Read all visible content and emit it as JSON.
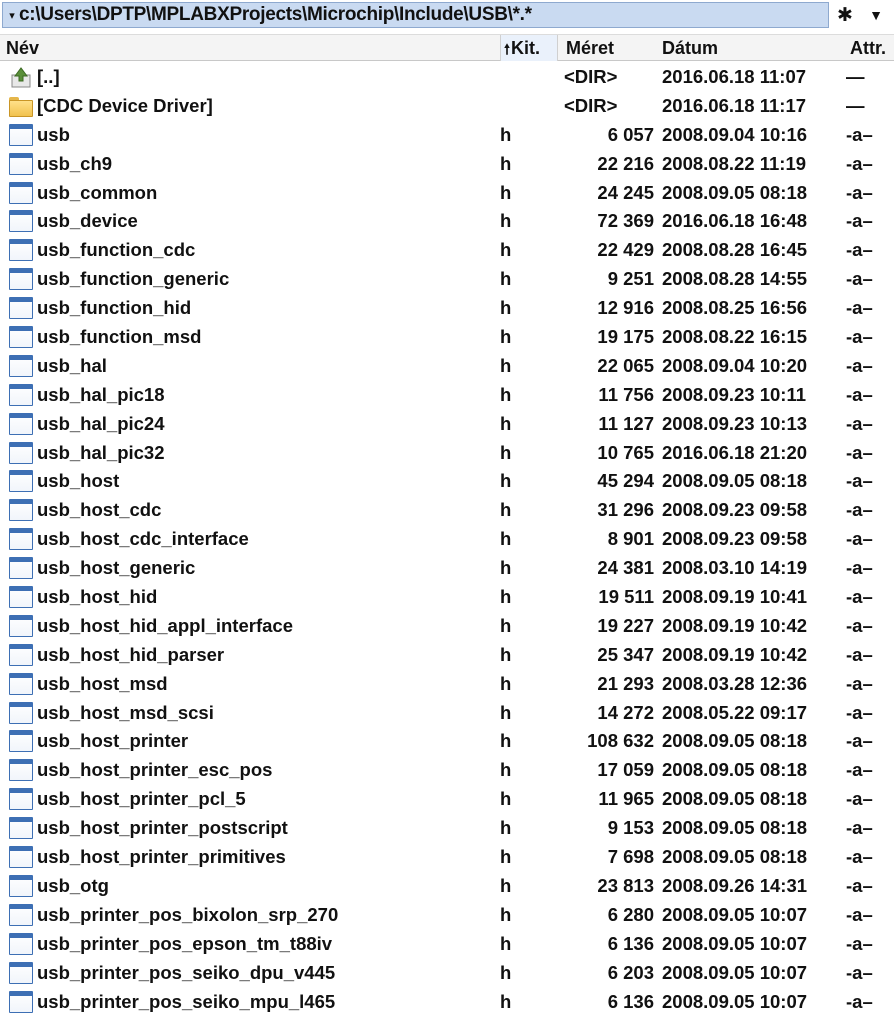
{
  "path": {
    "dropdown_glyph": "▾",
    "text": "c:\\Users\\DPTP\\MPLABXProjects\\Microchip\\Include\\USB\\*.*",
    "filter_glyph": "✱",
    "menu_glyph": "▼"
  },
  "columns": {
    "name": "Név",
    "ext_sort_glyph": "🠕",
    "ext": "Kit.",
    "size": "Méret",
    "date": "Dátum",
    "attr": "Attr."
  },
  "rows": [
    {
      "kind": "up",
      "name": "[..]",
      "ext": "",
      "size": "<DIR>",
      "date": "2016.06.18 11:07",
      "attr": "—"
    },
    {
      "kind": "folder",
      "name": "[CDC Device Driver]",
      "ext": "",
      "size": "<DIR>",
      "date": "2016.06.18 11:17",
      "attr": "—"
    },
    {
      "kind": "file",
      "name": "usb",
      "ext": "h",
      "size": "6 057",
      "date": "2008.09.04 10:16",
      "attr": "-a–"
    },
    {
      "kind": "file",
      "name": "usb_ch9",
      "ext": "h",
      "size": "22 216",
      "date": "2008.08.22 11:19",
      "attr": "-a–"
    },
    {
      "kind": "file",
      "name": "usb_common",
      "ext": "h",
      "size": "24 245",
      "date": "2008.09.05 08:18",
      "attr": "-a–"
    },
    {
      "kind": "file",
      "name": "usb_device",
      "ext": "h",
      "size": "72 369",
      "date": "2016.06.18 16:48",
      "attr": "-a–"
    },
    {
      "kind": "file",
      "name": "usb_function_cdc",
      "ext": "h",
      "size": "22 429",
      "date": "2008.08.28 16:45",
      "attr": "-a–"
    },
    {
      "kind": "file",
      "name": "usb_function_generic",
      "ext": "h",
      "size": "9 251",
      "date": "2008.08.28 14:55",
      "attr": "-a–"
    },
    {
      "kind": "file",
      "name": "usb_function_hid",
      "ext": "h",
      "size": "12 916",
      "date": "2008.08.25 16:56",
      "attr": "-a–"
    },
    {
      "kind": "file",
      "name": "usb_function_msd",
      "ext": "h",
      "size": "19 175",
      "date": "2008.08.22 16:15",
      "attr": "-a–"
    },
    {
      "kind": "file",
      "name": "usb_hal",
      "ext": "h",
      "size": "22 065",
      "date": "2008.09.04 10:20",
      "attr": "-a–"
    },
    {
      "kind": "file",
      "name": "usb_hal_pic18",
      "ext": "h",
      "size": "11 756",
      "date": "2008.09.23 10:11",
      "attr": "-a–"
    },
    {
      "kind": "file",
      "name": "usb_hal_pic24",
      "ext": "h",
      "size": "11 127",
      "date": "2008.09.23 10:13",
      "attr": "-a–"
    },
    {
      "kind": "file",
      "name": "usb_hal_pic32",
      "ext": "h",
      "size": "10 765",
      "date": "2016.06.18 21:20",
      "attr": "-a–"
    },
    {
      "kind": "file",
      "name": "usb_host",
      "ext": "h",
      "size": "45 294",
      "date": "2008.09.05 08:18",
      "attr": "-a–"
    },
    {
      "kind": "file",
      "name": "usb_host_cdc",
      "ext": "h",
      "size": "31 296",
      "date": "2008.09.23 09:58",
      "attr": "-a–"
    },
    {
      "kind": "file",
      "name": "usb_host_cdc_interface",
      "ext": "h",
      "size": "8 901",
      "date": "2008.09.23 09:58",
      "attr": "-a–"
    },
    {
      "kind": "file",
      "name": "usb_host_generic",
      "ext": "h",
      "size": "24 381",
      "date": "2008.03.10 14:19",
      "attr": "-a–"
    },
    {
      "kind": "file",
      "name": "usb_host_hid",
      "ext": "h",
      "size": "19 511",
      "date": "2008.09.19 10:41",
      "attr": "-a–"
    },
    {
      "kind": "file",
      "name": "usb_host_hid_appl_interface",
      "ext": "h",
      "size": "19 227",
      "date": "2008.09.19 10:42",
      "attr": "-a–"
    },
    {
      "kind": "file",
      "name": "usb_host_hid_parser",
      "ext": "h",
      "size": "25 347",
      "date": "2008.09.19 10:42",
      "attr": "-a–"
    },
    {
      "kind": "file",
      "name": "usb_host_msd",
      "ext": "h",
      "size": "21 293",
      "date": "2008.03.28 12:36",
      "attr": "-a–"
    },
    {
      "kind": "file",
      "name": "usb_host_msd_scsi",
      "ext": "h",
      "size": "14 272",
      "date": "2008.05.22 09:17",
      "attr": "-a–"
    },
    {
      "kind": "file",
      "name": "usb_host_printer",
      "ext": "h",
      "size": "108 632",
      "date": "2008.09.05 08:18",
      "attr": "-a–"
    },
    {
      "kind": "file",
      "name": "usb_host_printer_esc_pos",
      "ext": "h",
      "size": "17 059",
      "date": "2008.09.05 08:18",
      "attr": "-a–"
    },
    {
      "kind": "file",
      "name": "usb_host_printer_pcl_5",
      "ext": "h",
      "size": "11 965",
      "date": "2008.09.05 08:18",
      "attr": "-a–"
    },
    {
      "kind": "file",
      "name": "usb_host_printer_postscript",
      "ext": "h",
      "size": "9 153",
      "date": "2008.09.05 08:18",
      "attr": "-a–"
    },
    {
      "kind": "file",
      "name": "usb_host_printer_primitives",
      "ext": "h",
      "size": "7 698",
      "date": "2008.09.05 08:18",
      "attr": "-a–"
    },
    {
      "kind": "file",
      "name": "usb_otg",
      "ext": "h",
      "size": "23 813",
      "date": "2008.09.26 14:31",
      "attr": "-a–"
    },
    {
      "kind": "file",
      "name": "usb_printer_pos_bixolon_srp_270",
      "ext": "h",
      "size": "6 280",
      "date": "2008.09.05 10:07",
      "attr": "-a–"
    },
    {
      "kind": "file",
      "name": "usb_printer_pos_epson_tm_t88iv",
      "ext": "h",
      "size": "6 136",
      "date": "2008.09.05 10:07",
      "attr": "-a–"
    },
    {
      "kind": "file",
      "name": "usb_printer_pos_seiko_dpu_v445",
      "ext": "h",
      "size": "6 203",
      "date": "2008.09.05 10:07",
      "attr": "-a–"
    },
    {
      "kind": "file",
      "name": "usb_printer_pos_seiko_mpu_l465",
      "ext": "h",
      "size": "6 136",
      "date": "2008.09.05 10:07",
      "attr": "-a–"
    }
  ]
}
